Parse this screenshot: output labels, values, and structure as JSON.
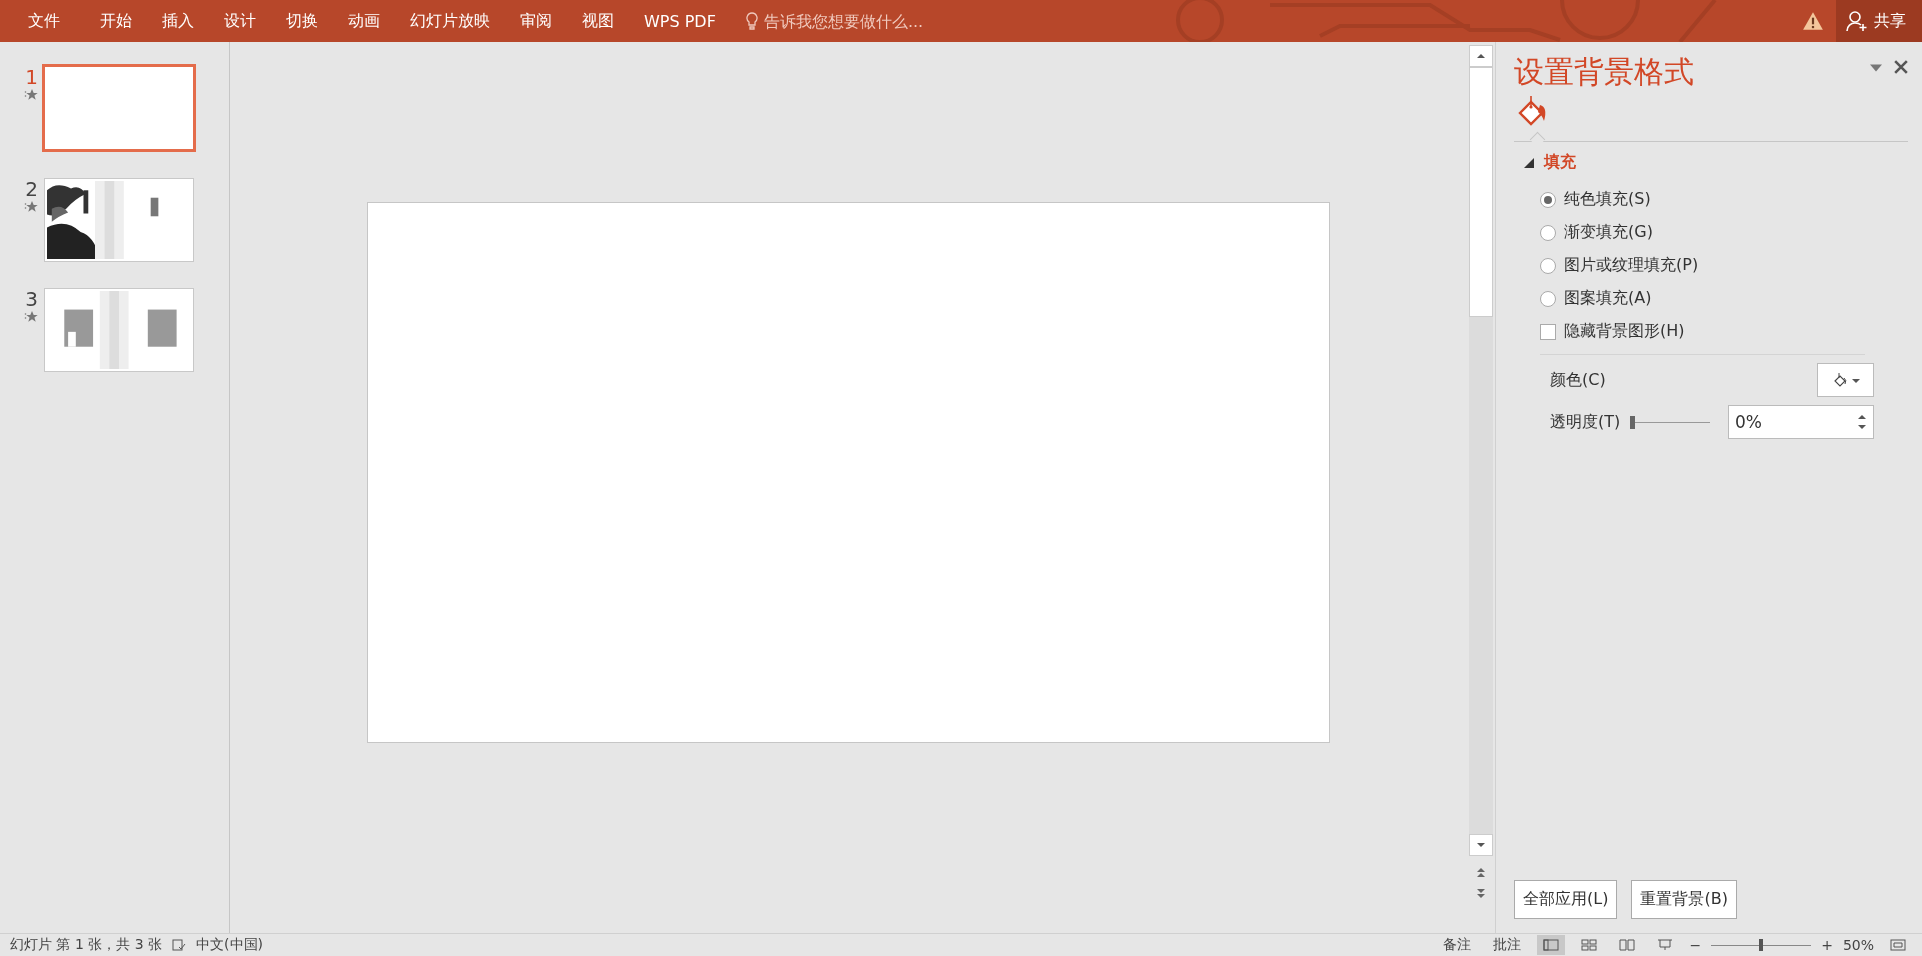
{
  "menu": [
    "文件",
    "开始",
    "插入",
    "设计",
    "切换",
    "动画",
    "幻灯片放映",
    "审阅",
    "视图",
    "WPS PDF"
  ],
  "tell_me": {
    "placeholder": "告诉我您想要做什么..."
  },
  "share_button": "共享",
  "slides": [
    {
      "number": "1",
      "selected": true,
      "kind": "blank"
    },
    {
      "number": "2",
      "selected": false,
      "kind": "landscape"
    },
    {
      "number": "3",
      "selected": false,
      "kind": "text"
    }
  ],
  "panel": {
    "title": "设置背景格式",
    "section": {
      "label": "填充",
      "expanded": true
    },
    "fill_options": [
      {
        "label": "纯色填充(S)",
        "selected": true
      },
      {
        "label": "渐变填充(G)",
        "selected": false
      },
      {
        "label": "图片或纹理填充(P)",
        "selected": false
      },
      {
        "label": "图案填充(A)",
        "selected": false
      }
    ],
    "hide_background": {
      "label": "隐藏背景图形(H)",
      "checked": false
    },
    "color_label": "颜色(C)",
    "transparency": {
      "label": "透明度(T)",
      "level": 0,
      "value": "0%"
    },
    "buttons": [
      "全部应用(L)",
      "重置背景(B)"
    ]
  },
  "status_bar": {
    "slide_info": "幻灯片 第 1 张，共 3 张",
    "language": "中文(中国)",
    "notes": "备注",
    "comments": "批注",
    "zoom_out": "−",
    "zoom_in": "+",
    "zoom": "50%",
    "zoom_slider": {
      "level": 0.5
    }
  }
}
